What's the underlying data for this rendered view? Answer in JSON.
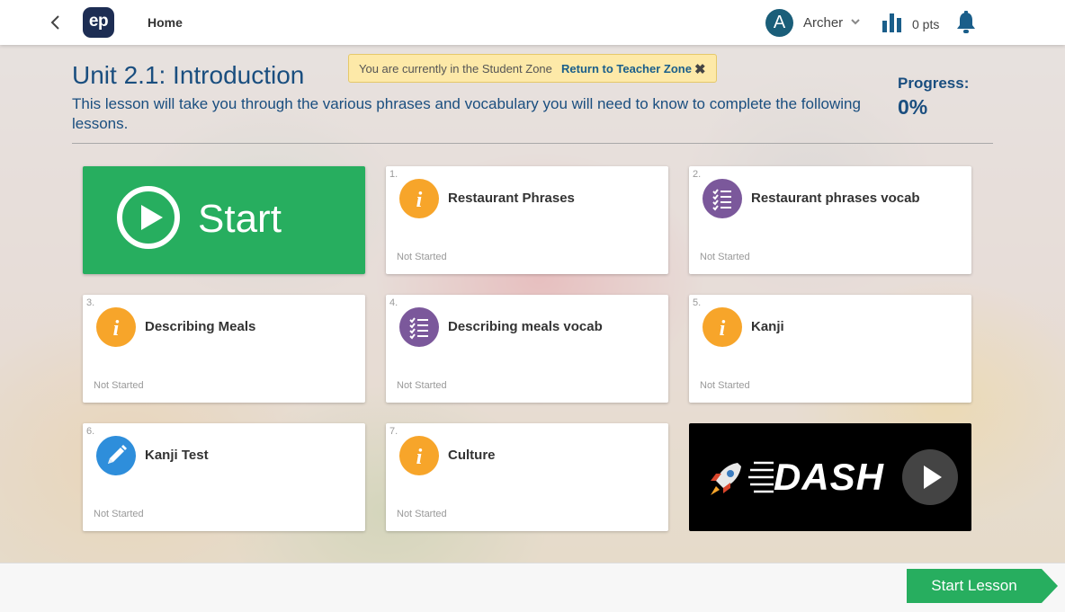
{
  "header": {
    "logo_text": "ep",
    "home_label": "Home",
    "user_initial": "A",
    "user_name": "Archer",
    "points": "0 pts"
  },
  "banner": {
    "text": "You are currently in the Student Zone",
    "link": "Return to Teacher Zone",
    "close_glyph": "✖"
  },
  "unit": {
    "title": "Unit 2.1: Introduction",
    "description": "This lesson will take you through the various phrases and vocabulary you will need to know to complete the following lessons.",
    "progress_label": "Progress:",
    "progress_value": "0%"
  },
  "start_tile": {
    "label": "Start"
  },
  "tasks": [
    {
      "num": "1.",
      "title": "Restaurant Phrases",
      "status": "Not Started",
      "icon": "info-icon"
    },
    {
      "num": "2.",
      "title": "Restaurant phrases vocab",
      "status": "Not Started",
      "icon": "list-icon"
    },
    {
      "num": "3.",
      "title": "Describing Meals",
      "status": "Not Started",
      "icon": "info-icon"
    },
    {
      "num": "4.",
      "title": "Describing meals vocab",
      "status": "Not Started",
      "icon": "list-icon"
    },
    {
      "num": "5.",
      "title": "Kanji",
      "status": "Not Started",
      "icon": "info-icon"
    },
    {
      "num": "6.",
      "title": "Kanji Test",
      "status": "Not Started",
      "icon": "pencil-icon"
    },
    {
      "num": "7.",
      "title": "Culture",
      "status": "Not Started",
      "icon": "info-icon"
    }
  ],
  "dash": {
    "label": "DASH"
  },
  "footer": {
    "start_lesson": "Start Lesson"
  },
  "colors": {
    "primary_blue": "#1a4e7f",
    "green": "#27ae5f",
    "info_orange": "#f7a52a",
    "vocab_purple": "#7b589b",
    "test_blue": "#2e8edb"
  }
}
